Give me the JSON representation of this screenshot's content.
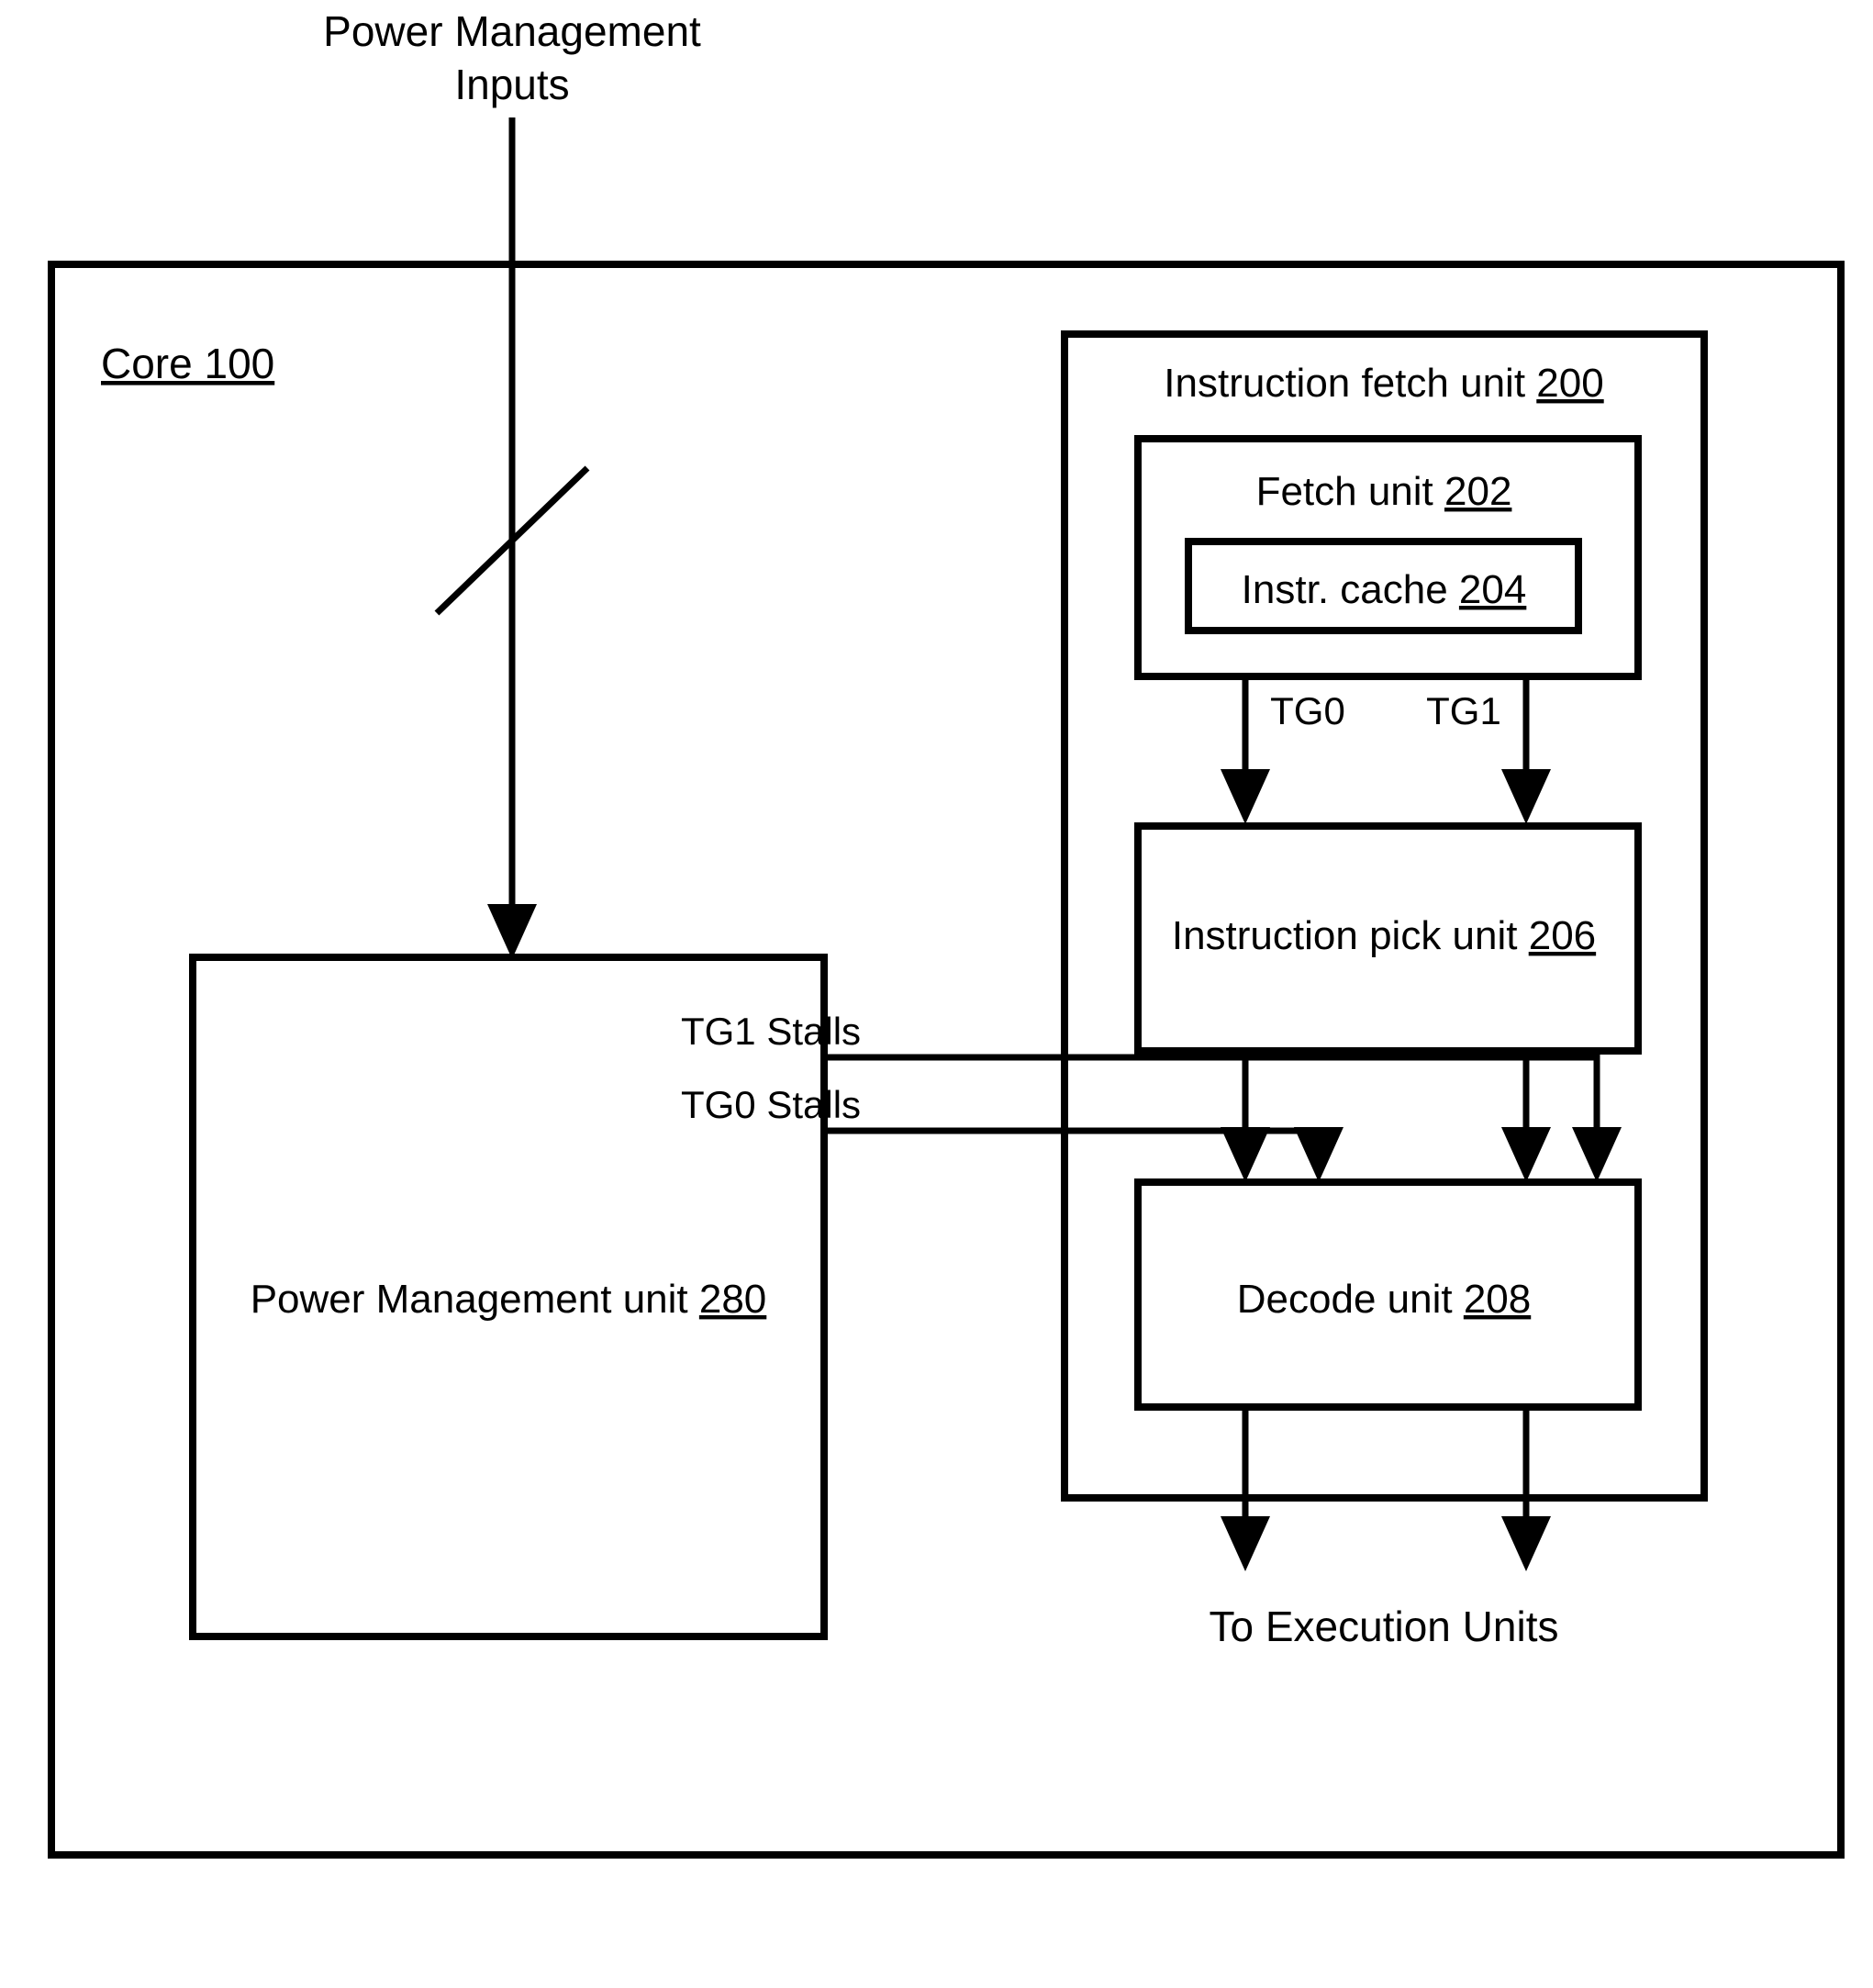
{
  "figure": {
    "title_note": "Processor core power management block diagram",
    "top_signal": {
      "label_line1": "Power Management",
      "label_line2": "Inputs",
      "bus_marker": "bus-slash"
    },
    "bottom_label": "To Execution Units"
  },
  "boxes": {
    "core": {
      "label_text": "Core 100",
      "label_prefix": "Core ",
      "label_ref": "100",
      "underline_all": true
    },
    "pmu": {
      "label_text": "Power Management unit 280",
      "label_prefix": "Power Management unit ",
      "label_ref": "280"
    },
    "ifu": {
      "label_text": "Instruction fetch unit 200",
      "label_prefix": "Instruction fetch unit ",
      "label_ref": "200"
    },
    "fetch_unit": {
      "label_text": "Fetch unit 202",
      "label_prefix": "Fetch unit ",
      "label_ref": "202"
    },
    "instr_cache": {
      "label_text": "Instr. cache 204",
      "label_prefix": "Instr. cache ",
      "label_ref": "204"
    },
    "pick_unit": {
      "label_text": "Instruction pick unit 206",
      "label_prefix": "Instruction pick unit ",
      "label_ref": "206"
    },
    "decode_unit": {
      "label_text": "Decode unit  208",
      "label_prefix": "Decode unit ",
      "label_ref": " 208"
    }
  },
  "signals": {
    "tg0": "TG0",
    "tg1": "TG1",
    "tg1_stalls": "TG1 Stalls",
    "tg0_stalls": "TG0 Stalls"
  },
  "colors": {
    "line": "#000000",
    "background": "#ffffff",
    "text": "#000000"
  }
}
